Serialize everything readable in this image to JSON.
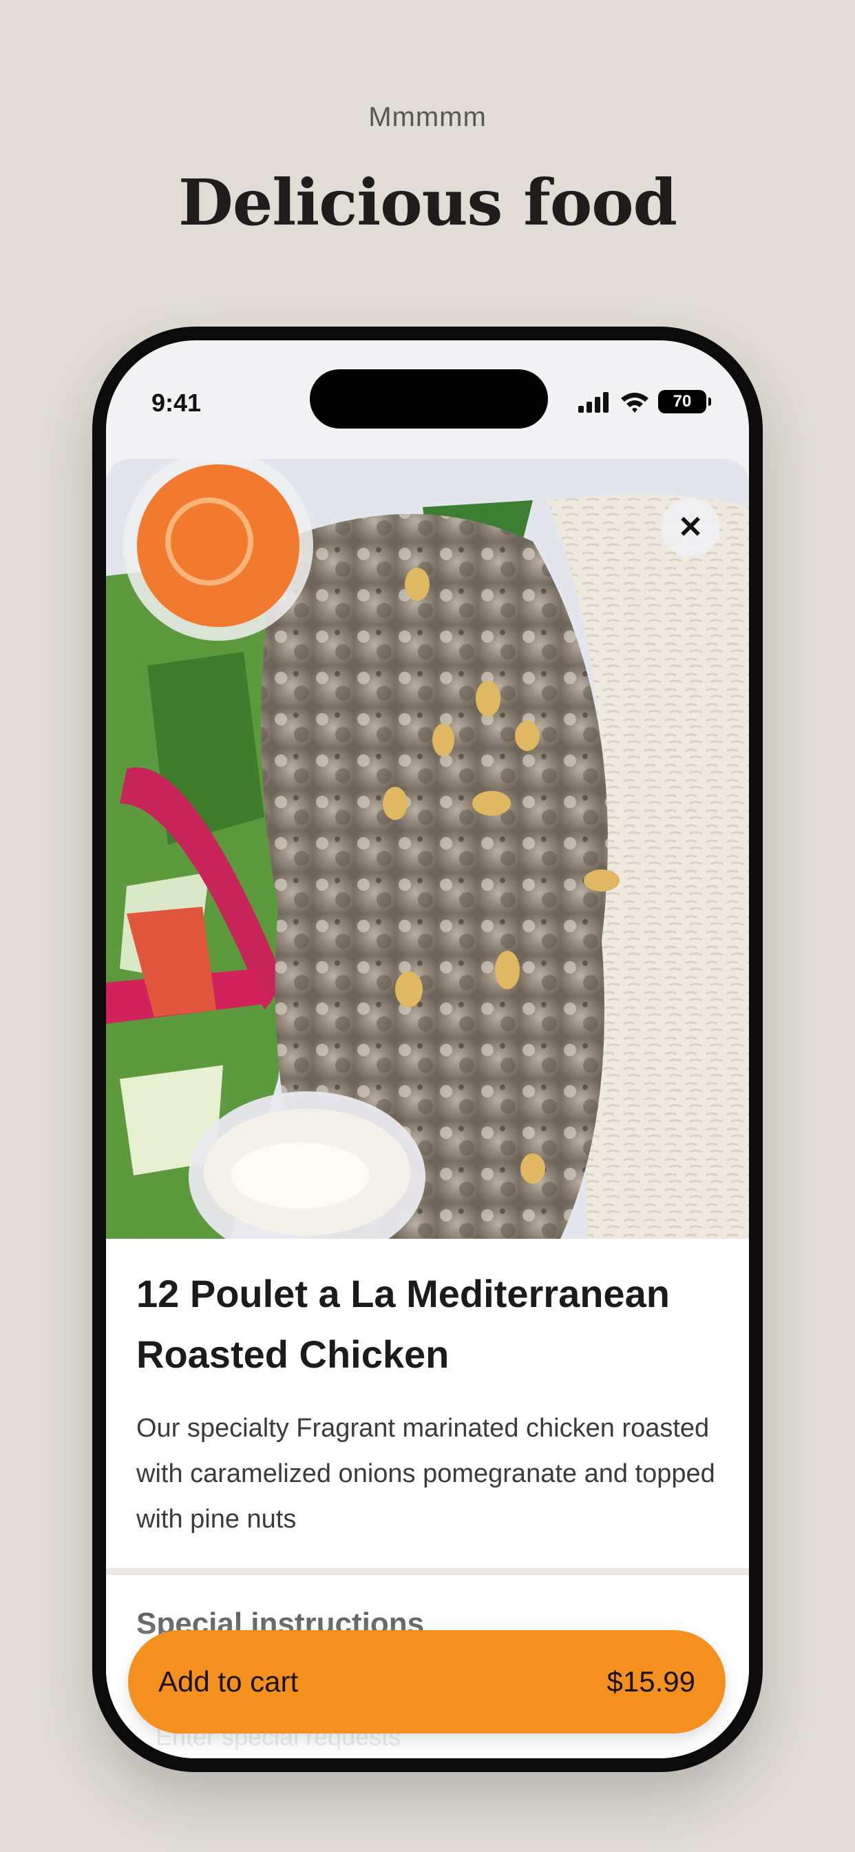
{
  "header": {
    "eyebrow": "Mmmmm",
    "title": "Delicious food"
  },
  "status_bar": {
    "time": "9:41",
    "battery": "70"
  },
  "item": {
    "title": "12 Poulet a La Mediterranean Roasted Chicken",
    "description": "Our specialty Fragrant marinated chicken roasted with caramelized onions pomegranate and topped with pine nuts"
  },
  "special": {
    "label": "Special instructions",
    "placeholder": "Enter special requests"
  },
  "cart": {
    "label": "Add to cart",
    "price": "$15.99"
  },
  "colors": {
    "accent": "#f4911e",
    "background": "#e1dcd6"
  },
  "icons": {
    "close": "close-icon",
    "signal": "signal-icon",
    "wifi": "wifi-icon",
    "battery": "battery-icon"
  }
}
